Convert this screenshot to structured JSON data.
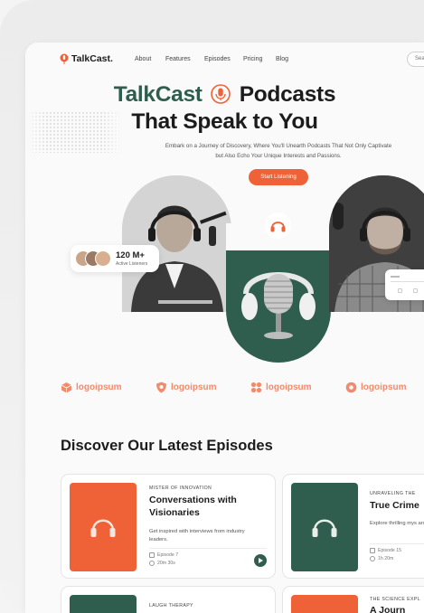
{
  "brand": {
    "name": "TalkCast.",
    "accent": "#ef6237",
    "green": "#2f5e4e"
  },
  "nav": {
    "links": [
      "About",
      "Features",
      "Episodes",
      "Pricing",
      "Blog"
    ],
    "search_label": "Sea"
  },
  "hero": {
    "title_part1": "TalkCast",
    "title_part2": "Podcasts",
    "title_line2": "That Speak to You",
    "subtitle": "Embark on a Journey of Discovery, Where You'll Unearth Podcasts That Not Only Captivate but Also Echo Your Unique Interests and Passions.",
    "cta": "Start Listening",
    "listeners_count": "120 M+",
    "listeners_label": "Active Listeners"
  },
  "partners": [
    "logoipsum",
    "logoipsum",
    "logoipsum",
    "logoipsum"
  ],
  "episodes_section": {
    "title": "Discover Our Latest Episodes",
    "cards": [
      {
        "kicker": "Mister of Innovation",
        "title": "Conversations with Visionaries",
        "desc": "Get inspired with interviews from industry leaders.",
        "episode": "Episode 7",
        "duration": "20m 30s",
        "thumb_color": "#ef6237"
      },
      {
        "kicker": "Unraveling the",
        "title": "True Crime",
        "desc": "Explore thrilling mys around the world",
        "episode": "Episode 15",
        "duration": "1h 20m",
        "thumb_color": "#2f5e4e"
      },
      {
        "kicker": "Laugh Therapy",
        "title": "",
        "thumb_color": "#2f5e4e"
      },
      {
        "kicker": "The Science Expl",
        "title": "A Journ",
        "thumb_color": "#ef6237"
      }
    ]
  }
}
